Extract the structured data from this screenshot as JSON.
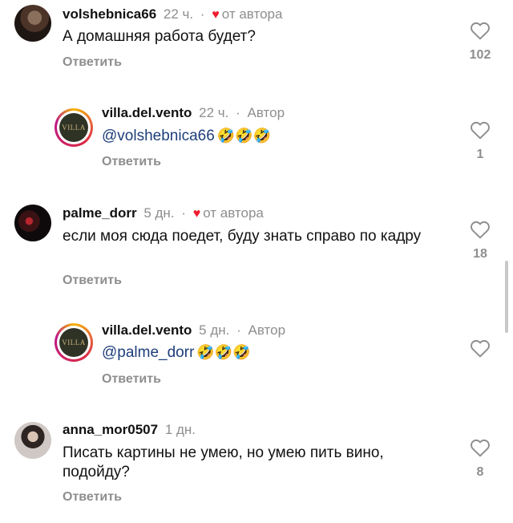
{
  "comments": [
    {
      "username": "volshebnica66",
      "time": "22 ч.",
      "separator": "·",
      "liked_label": "от автора",
      "text": "А домашняя работа будет?",
      "reply_label": "Ответить",
      "likes": "102"
    },
    {
      "username": "villa.del.vento",
      "avatar_text": "VILLA",
      "time": "22 ч.",
      "separator": "·",
      "author_badge": "Автор",
      "mention": "@volshebnica66",
      "emojis": "🤣🤣🤣",
      "reply_label": "Ответить",
      "likes": "1"
    },
    {
      "username": "palme_dorr",
      "time": "5 дн.",
      "separator": "·",
      "liked_label": "от автора",
      "text": "если моя сюда поедет, буду знать справо по кадру",
      "reply_label": "Ответить",
      "likes": "18"
    },
    {
      "username": "villa.del.vento",
      "avatar_text": "VILLA",
      "time": "5 дн.",
      "separator": "·",
      "author_badge": "Автор",
      "mention": "@palme_dorr",
      "emojis": "🤣🤣🤣",
      "reply_label": "Ответить"
    },
    {
      "username": "anna_mor0507",
      "time": "1 дн.",
      "text": "Писать картины не умею, но умею пить вино, подойду?",
      "reply_label": "Ответить",
      "likes": "8"
    }
  ],
  "colors": {
    "heart": "#ed1c2f",
    "mention": "#1d3e7a",
    "muted": "#8e8e8e"
  },
  "icons": {
    "like": "heart-outline-icon",
    "author_like": "heart-filled-icon"
  }
}
